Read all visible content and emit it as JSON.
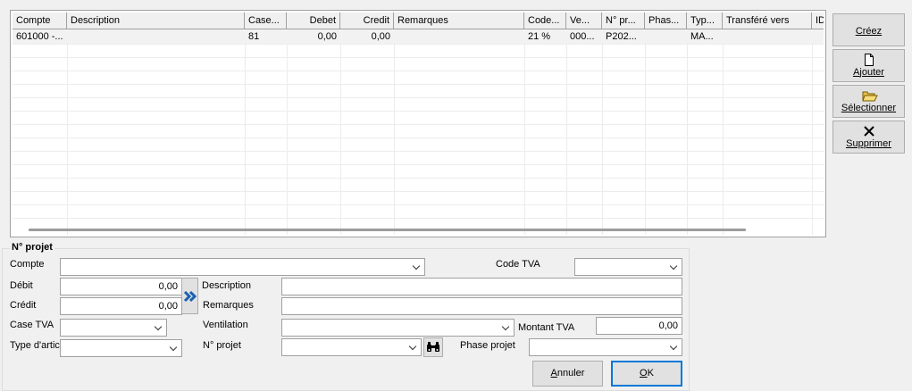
{
  "grid": {
    "columns": [
      "Compte",
      "Description",
      "Case...",
      "Debet",
      "Credit",
      "Remarques",
      "Code...",
      "Ve...",
      "N° pr...",
      "Phas...",
      "Typ...",
      "Transféré vers",
      "ID"
    ],
    "rows": [
      [
        "601000 -...",
        "",
        "81",
        "0,00",
        "0,00",
        "",
        "21 %",
        "000...",
        "P202...",
        "",
        "MA...",
        "",
        ""
      ]
    ]
  },
  "side_buttons": {
    "cree": {
      "accel": "C",
      "rest": "réez"
    },
    "ajouter": {
      "accel": "A",
      "rest": "jouter"
    },
    "selectionner": {
      "accel": "S",
      "rest": "électionner"
    },
    "supprimer": {
      "accel": "S",
      "rest": "upprimer"
    }
  },
  "form": {
    "group_title": "N° projet",
    "compte_label": "Compte",
    "compte_value": "",
    "code_tva_label": "Code TVA",
    "code_tva_value": "",
    "debit_label": "Débit",
    "debit_value": "0,00",
    "credit_label": "Crédit",
    "credit_value": "0,00",
    "description_label": "Description",
    "description_value": "",
    "remarques_label": "Remarques",
    "remarques_value": "",
    "case_tva_label": "Case TVA",
    "case_tva_value": "",
    "ventilation_label": "Ventilation",
    "ventilation_value": "",
    "montant_tva_label": "Montant TVA",
    "montant_tva_value": "0,00",
    "type_article_label": "Type d'artic",
    "type_article_value": "",
    "n_projet_label": "N° projet",
    "n_projet_value": "",
    "phase_projet_label": "Phase projet",
    "phase_projet_value": ""
  },
  "buttons": {
    "annuler": {
      "accel": "A",
      "rest": "nnuler"
    },
    "ok": {
      "accel": "O",
      "rest": "K"
    }
  },
  "colors": {
    "accent": "#0078d7",
    "arrow": "#1a5fb4",
    "row_bg": "#f2f2f2"
  }
}
